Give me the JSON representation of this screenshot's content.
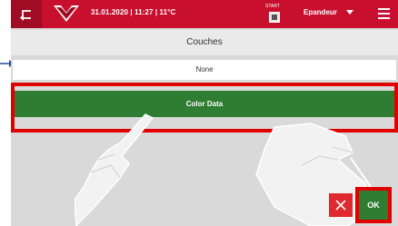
{
  "topbar": {
    "datetime": "31.01.2020 | 11:27 | 11°C",
    "start_label": "START",
    "mode": "Epandeur",
    "back_icon": "back-arrow-icon",
    "menu_icon": "hamburger-menu-icon",
    "chevron_icon": "chevron-down-icon",
    "bg_color": "#c8102e"
  },
  "page": {
    "title": "Couches"
  },
  "options": [
    {
      "label": "None",
      "selected": false
    },
    {
      "label": "Color Data",
      "selected": true
    }
  ],
  "actions": {
    "ok_label": "OK",
    "cancel_icon": "close-icon"
  },
  "colors": {
    "accent_green": "#2e7d32",
    "brand_red": "#c8102e",
    "highlight_red": "#e00000"
  }
}
